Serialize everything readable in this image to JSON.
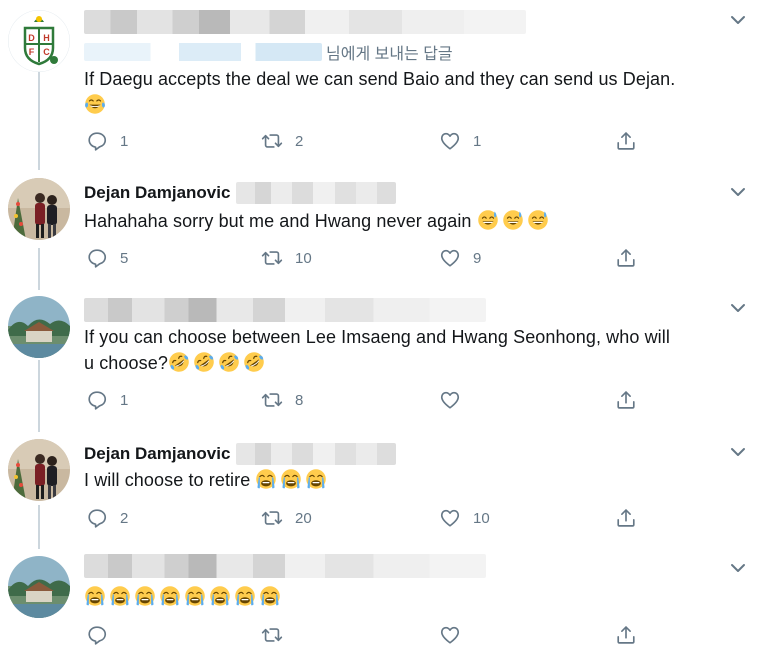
{
  "tweets": [
    {
      "name": "",
      "reply_to_suffix": "님에게 보내는 답글",
      "text": "If Daegu accepts the deal we can send Baio and they can send us Dejan.",
      "emoji_count": 1,
      "emoji_type": "face-with-tears-of-joy",
      "replies": "1",
      "retweets": "2",
      "likes": "1"
    },
    {
      "name": "Dejan Damjanovic",
      "text": "Hahahaha sorry but me and Hwang never again",
      "emoji_count": 3,
      "emoji_type": "grinning-face-with-sweat",
      "replies": "5",
      "retweets": "10",
      "likes": "9"
    },
    {
      "name": "",
      "text_line1": "If you can choose between Lee Imsaeng and Hwang Seonhong, who will",
      "text_line2": "u choose?",
      "emoji_count": 4,
      "emoji_type": "rolling-on-the-floor-laughing",
      "replies": "1",
      "retweets": "8",
      "likes": ""
    },
    {
      "name": "Dejan Damjanovic",
      "text": "I will choose to retire",
      "emoji_count": 3,
      "emoji_type": "loudly-crying-face",
      "replies": "2",
      "retweets": "20",
      "likes": "10"
    },
    {
      "name": "",
      "text": "",
      "emoji_count": 8,
      "emoji_type": "loudly-crying-face",
      "replies": "",
      "retweets": "",
      "likes": ""
    }
  ],
  "icons": {
    "reply": "reply-icon",
    "retweet": "retweet-icon",
    "like": "heart-icon",
    "share": "share-icon",
    "more": "chevron-down-icon"
  },
  "colors": {
    "text": "#14171a",
    "muted": "#657786",
    "thread_line": "#ccd6dd",
    "emoji_yellow": "#ffcc4d",
    "emoji_tear": "#5dadec"
  }
}
